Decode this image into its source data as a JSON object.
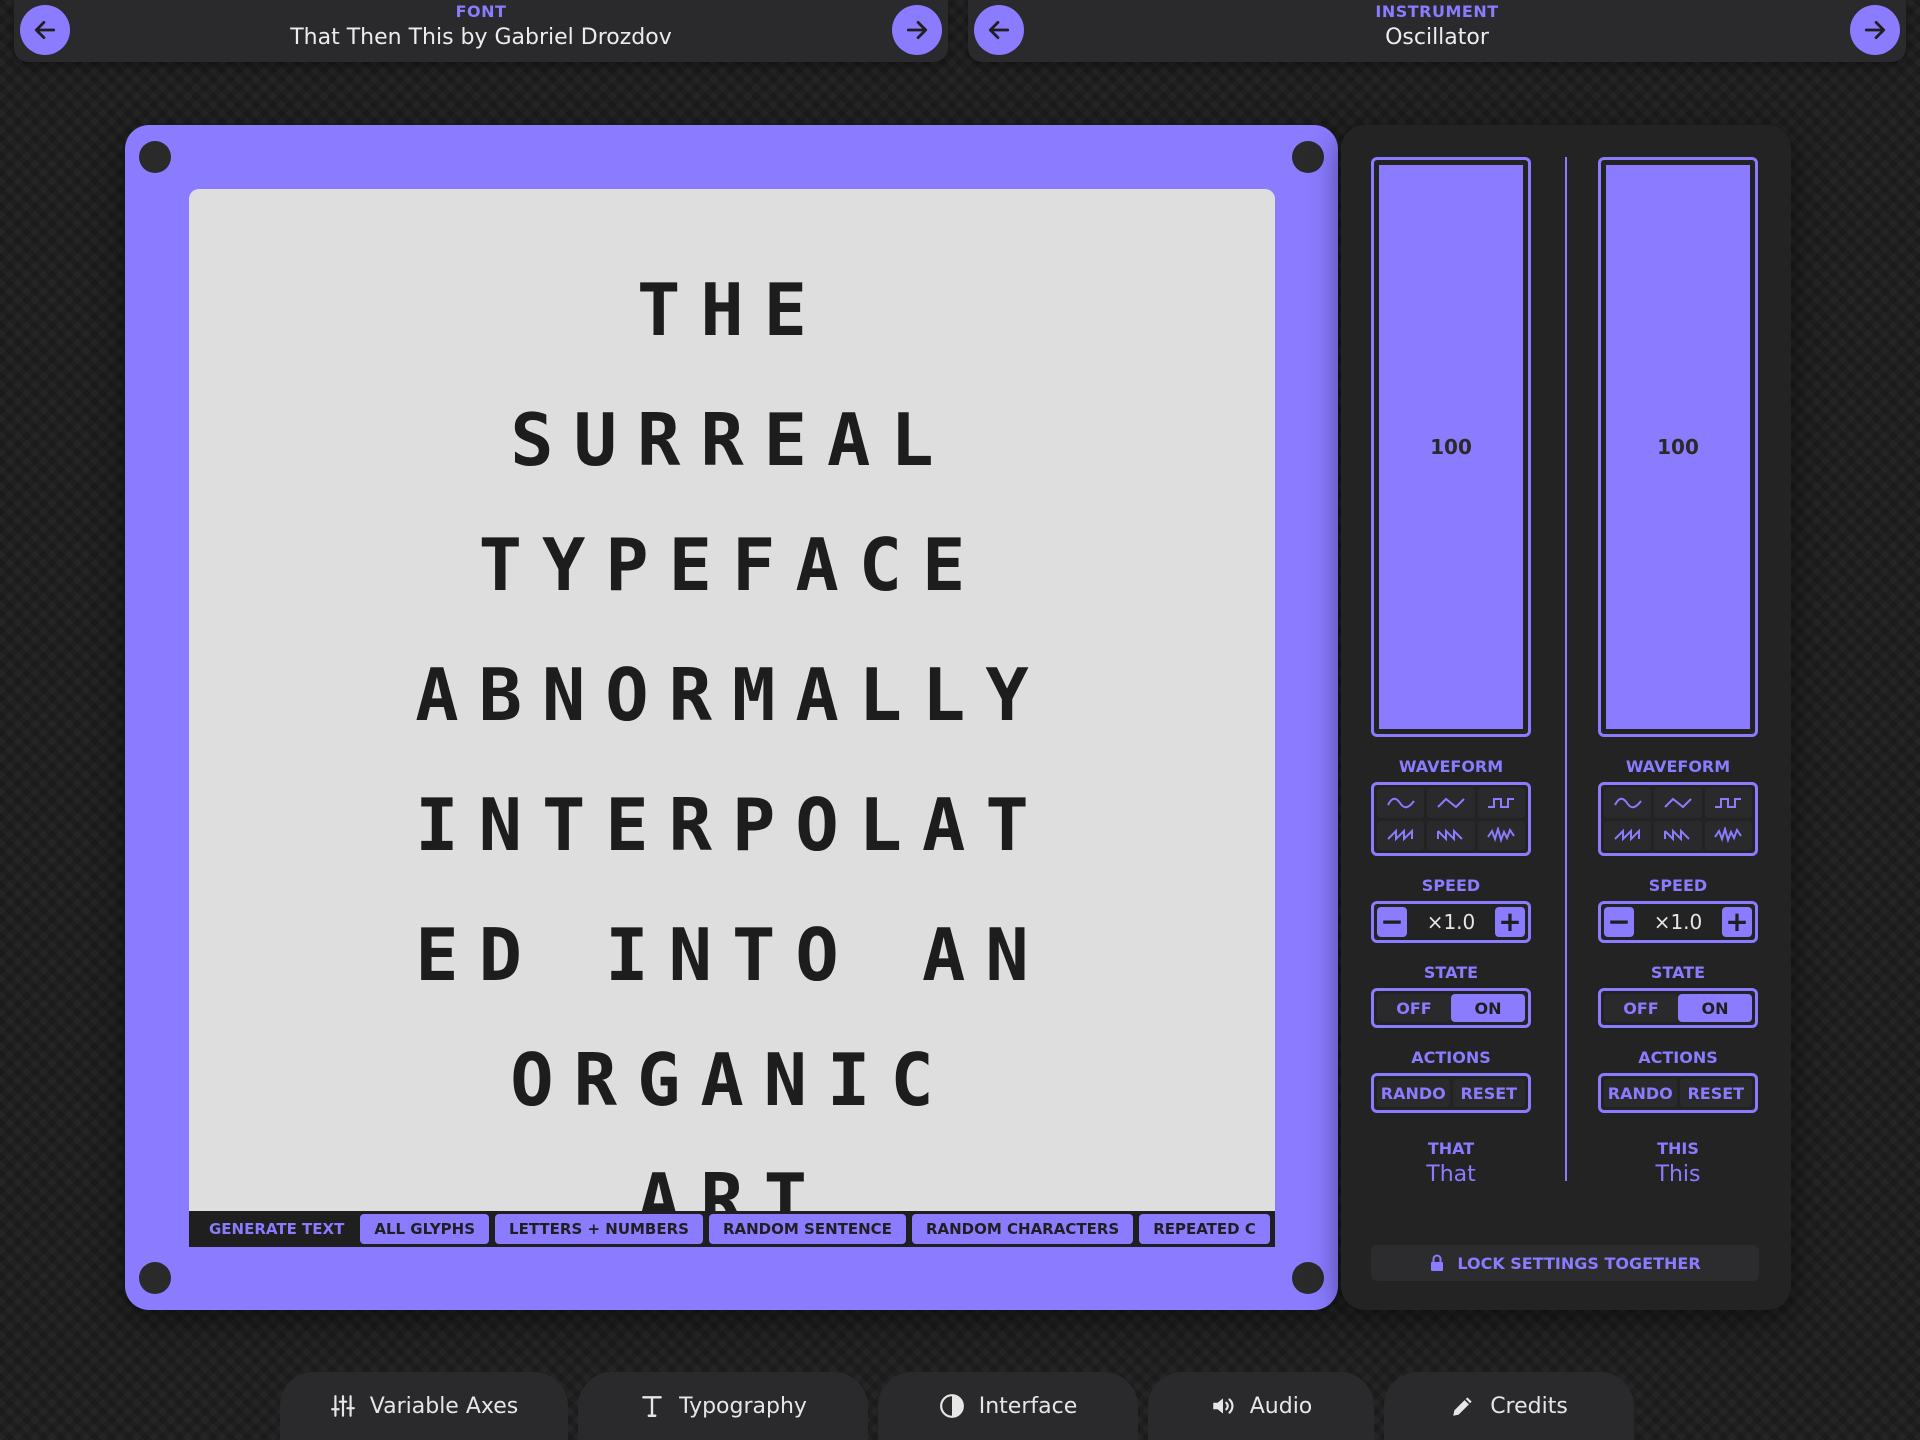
{
  "font_bar": {
    "caption": "FONT",
    "value": "That Then This by Gabriel Drozdov"
  },
  "instrument_bar": {
    "caption": "INSTRUMENT",
    "value": "Oscillator"
  },
  "preview": {
    "lines": [
      "THE",
      "SURREAL",
      "TYPEFACE",
      "ABNORMALLY",
      "INTERPOLAT",
      "ED INTO AN",
      "ORGANIC",
      "ART"
    ]
  },
  "toolbar": {
    "label": "GENERATE TEXT",
    "buttons": [
      "ALL GLYPHS",
      "LETTERS + NUMBERS",
      "RANDOM SENTENCE",
      "RANDOM CHARACTERS",
      "REPEATED C"
    ]
  },
  "axes": [
    {
      "slider_value": "100",
      "waveform_label": "WAVEFORM",
      "speed_label": "SPEED",
      "speed_value": "×1.0",
      "state_label": "STATE",
      "state_off": "OFF",
      "state_on": "ON",
      "actions_label": "ACTIONS",
      "rando": "RANDO",
      "reset": "RESET",
      "axis_caption": "THAT",
      "axis_name": "That"
    },
    {
      "slider_value": "100",
      "waveform_label": "WAVEFORM",
      "speed_label": "SPEED",
      "speed_value": "×1.0",
      "state_label": "STATE",
      "state_off": "OFF",
      "state_on": "ON",
      "actions_label": "ACTIONS",
      "rando": "RANDO",
      "reset": "RESET",
      "axis_caption": "THIS",
      "axis_name": "This"
    }
  ],
  "lock": {
    "label": "LOCK SETTINGS TOGETHER"
  },
  "tabs": [
    "Variable Axes",
    "Typography",
    "Interface",
    "Audio",
    "Credits"
  ],
  "colors": {
    "accent": "#8a7bff",
    "background": "#1d1d1d",
    "panel": "#232324",
    "screen": "#dedede"
  },
  "icons": [
    "arrow-left-icon",
    "arrow-right-icon",
    "sliders-icon",
    "type-icon",
    "contrast-icon",
    "speaker-icon",
    "pencil-icon",
    "lock-icon",
    "sine-wave-icon",
    "triangle-wave-icon",
    "square-wave-icon",
    "sawtooth-wave-icon",
    "reverse-sawtooth-wave-icon",
    "noise-wave-icon"
  ]
}
